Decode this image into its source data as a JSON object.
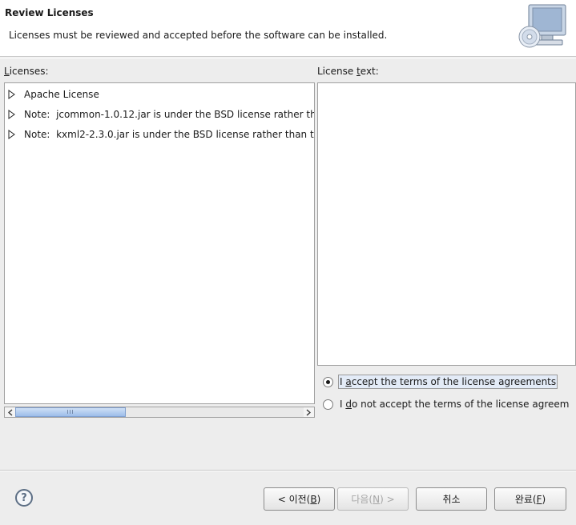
{
  "header": {
    "title": "Review Licenses",
    "description": "Licenses must be reviewed and accepted before the software can be installed.",
    "image_icon": "computer-cd-icon"
  },
  "licenses": {
    "label_mnemonic": "L",
    "label_rest": "icenses:",
    "items": [
      {
        "label": "Apache License"
      },
      {
        "label": "Note:  jcommon-1.0.12.jar is under the BSD license rather th"
      },
      {
        "label": "Note:  kxml2-2.3.0.jar is under the BSD license rather than t"
      }
    ],
    "scroll_thumb_grip": "III"
  },
  "license_text": {
    "label_pre": "License ",
    "label_mnemonic": "t",
    "label_post": "ext:",
    "value": ""
  },
  "options": {
    "accept": {
      "pre": "I ",
      "mnemonic": "a",
      "post": "ccept the terms of the license agreements",
      "checked": true
    },
    "decline": {
      "pre": "I ",
      "mnemonic": "d",
      "post": "o not accept the terms of the license agreem",
      "checked": false
    }
  },
  "buttons": {
    "back": {
      "pre": "< 이전(",
      "mnemonic": "B",
      "post": ")"
    },
    "next": {
      "pre": "다음(",
      "mnemonic": "N",
      "post": ") >"
    },
    "cancel": "취소",
    "finish": {
      "pre": "완료(",
      "mnemonic": "F",
      "post": ")"
    }
  },
  "help": {
    "glyph": "?"
  },
  "colors": {
    "scroll_thumb": "#9dbde9",
    "focus_bg": "#e3ebf7"
  }
}
